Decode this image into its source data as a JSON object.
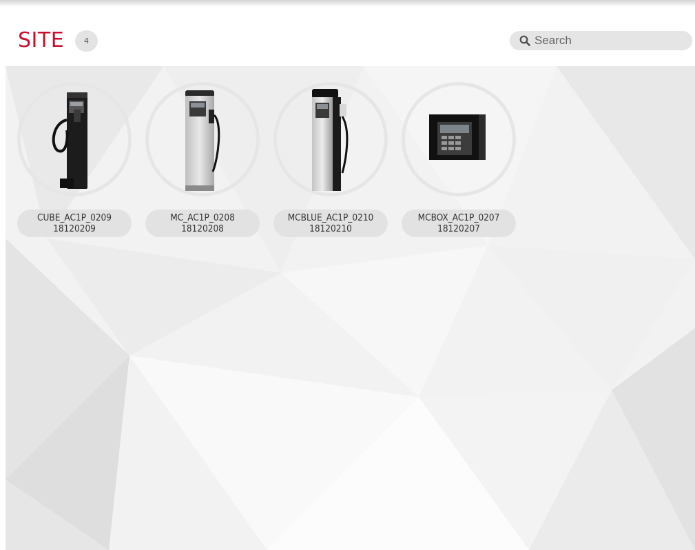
{
  "header": {
    "title": "SITE",
    "count": "4",
    "title_color": "#c8102e"
  },
  "search": {
    "placeholder": "Search",
    "value": "",
    "icon": "search-icon"
  },
  "devices": [
    {
      "name": "CUBE_AC1P_0209",
      "serial": "18120209",
      "icon": "cube-fuel-dispenser"
    },
    {
      "name": "MC_AC1P_0208",
      "serial": "18120208",
      "icon": "silver-fuel-dispenser"
    },
    {
      "name": "MCBLUE_AC1P_0210",
      "serial": "18120210",
      "icon": "silver-fuel-dispenser-nozzle"
    },
    {
      "name": "MCBOX_AC1P_0207",
      "serial": "18120207",
      "icon": "wall-control-box"
    }
  ]
}
